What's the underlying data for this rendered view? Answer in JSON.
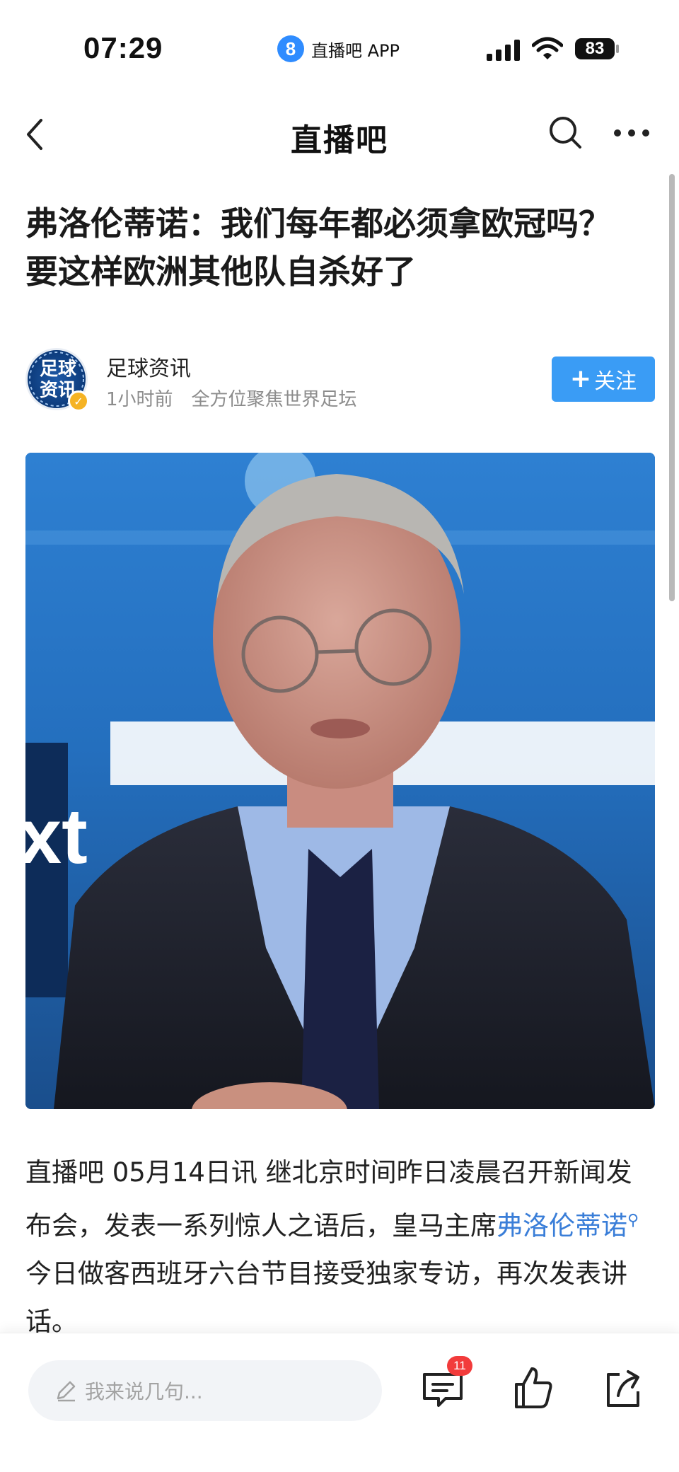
{
  "status_bar": {
    "time": "07:29",
    "app_logo_glyph": "8",
    "app_name": "直播吧 APP",
    "battery_level": "83"
  },
  "nav": {
    "title": "直播吧",
    "icons": [
      "back-icon",
      "search-icon",
      "more-icon"
    ]
  },
  "article": {
    "headline": "弗洛伦蒂诺：我们每年都必须拿欧冠吗？要这样欧洲其他队自杀好了",
    "author": {
      "name": "足球资讯",
      "avatar_text": "足球资讯",
      "time_ago": "1小时前",
      "description": "全方位聚焦世界足坛",
      "follow_label": "关注",
      "follow_plus": "+"
    },
    "body_before": "直播吧 05月14日讯 继北京时间昨日凌晨召开新闻发布会，发表一系列惊人之语后，皇马主席",
    "body_keyword": "弗洛伦蒂诺",
    "body_after": "今日做客西班牙六台节目接受独家专访，再次发表讲话。"
  },
  "bottom_bar": {
    "comment_placeholder": "我来说几句...",
    "comment_count": "11"
  },
  "colors": {
    "accent": "#3a9cf5",
    "keyword": "#3a7ed8",
    "badge": "#f23b3b"
  }
}
